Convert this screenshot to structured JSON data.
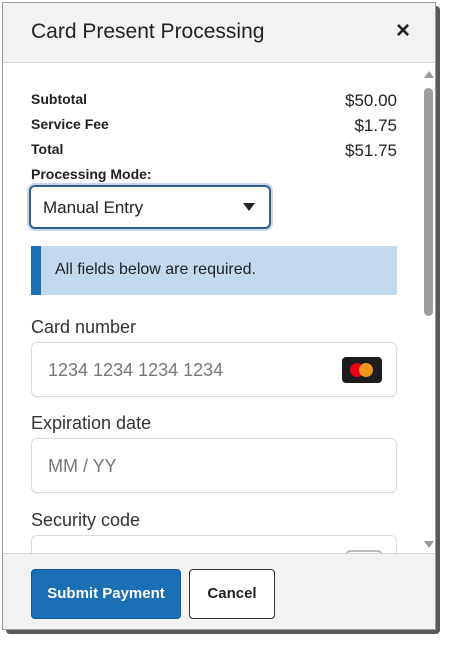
{
  "dialog": {
    "title": "Card Present Processing",
    "close_icon": "close-icon",
    "close_glyph": "×"
  },
  "summary": {
    "subtotal_label": "Subtotal",
    "subtotal_value": "$50.00",
    "service_fee_label": "Service Fee",
    "service_fee_value": "$1.75",
    "total_label": "Total",
    "total_value": "$51.75"
  },
  "processing_mode": {
    "label": "Processing Mode:",
    "selected": "Manual Entry"
  },
  "alert": {
    "text": "All fields below are required.",
    "accent_color": "#1b6fb5",
    "background_color": "#c3d9ee"
  },
  "fields": {
    "card_number": {
      "label": "Card number",
      "placeholder": "1234 1234 1234 1234",
      "icon": "mastercard-icon"
    },
    "expiration": {
      "label": "Expiration date",
      "placeholder": "MM / YY"
    },
    "security_code": {
      "label": "Security code",
      "icon": "cvc-card-icon"
    }
  },
  "footer": {
    "submit_label": "Submit Payment",
    "cancel_label": "Cancel"
  },
  "colors": {
    "primary": "#1b6fb5"
  }
}
